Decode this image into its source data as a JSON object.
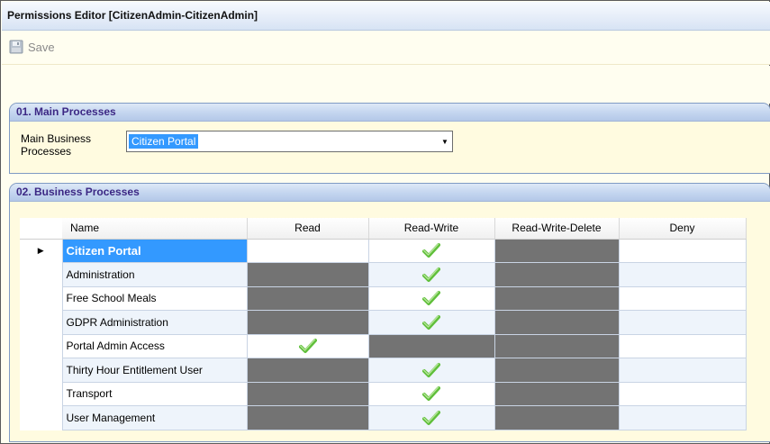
{
  "window": {
    "title": "Permissions Editor [CitizenAdmin-CitizenAdmin]"
  },
  "toolbar": {
    "save_label": "Save",
    "save_icon": "floppy-disk-icon"
  },
  "main_processes": {
    "header": "01. Main Processes",
    "field_label": "Main Business Processes",
    "selected_value": "Citizen Portal",
    "dropdown_icon": "dropdown-arrow-icon"
  },
  "business_processes": {
    "header": "02. Business Processes",
    "columns": [
      "Name",
      "Read",
      "Read-Write",
      "Read-Write-Delete",
      "Deny"
    ],
    "rows": [
      {
        "name": "Citizen Portal",
        "cells": [
          "empty",
          "check",
          "grey",
          "empty"
        ]
      },
      {
        "name": "Administration",
        "cells": [
          "grey",
          "check",
          "grey",
          "empty"
        ]
      },
      {
        "name": "Free School Meals",
        "cells": [
          "grey",
          "check",
          "grey",
          "empty"
        ]
      },
      {
        "name": "GDPR Administration",
        "cells": [
          "grey",
          "check",
          "grey",
          "empty"
        ]
      },
      {
        "name": "Portal Admin Access",
        "cells": [
          "check",
          "grey",
          "grey",
          "empty"
        ]
      },
      {
        "name": "Thirty Hour Entitlement User",
        "cells": [
          "grey",
          "check",
          "grey",
          "empty"
        ]
      },
      {
        "name": "Transport",
        "cells": [
          "grey",
          "check",
          "grey",
          "empty"
        ]
      },
      {
        "name": "User Management",
        "cells": [
          "grey",
          "check",
          "grey",
          "empty"
        ]
      }
    ],
    "current_row": 0,
    "colors": {
      "selected": "#3399ff",
      "unavailable": "#737373",
      "check": "#5fbf3a"
    }
  }
}
